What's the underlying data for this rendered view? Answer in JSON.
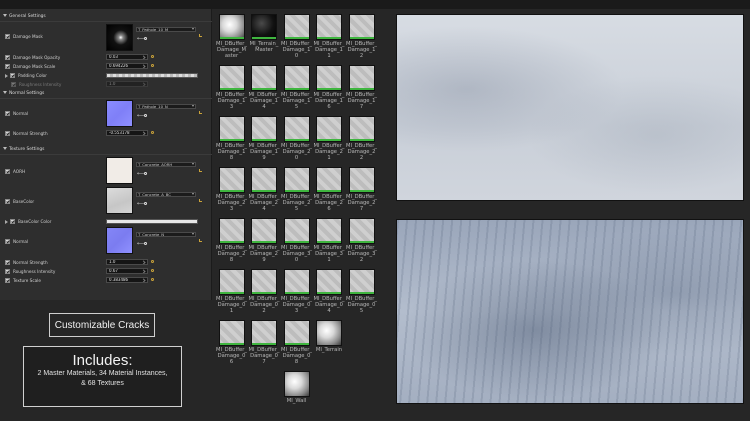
{
  "sections": {
    "general": "General Settings",
    "normal": "Normal Settings",
    "texture": "Texture Settings"
  },
  "general": {
    "damage_mask": {
      "label": "Damage Mask",
      "texture": "T_Pathole_10_M"
    },
    "opacity": {
      "label": "Damage Mask Opacity",
      "value": "0.03"
    },
    "scale": {
      "label": "Damage Mask Scale",
      "value": "0.694226"
    },
    "padding": {
      "label": "Padding Color"
    },
    "roughness": {
      "label": "Roughness Intensity",
      "value": "1.0"
    }
  },
  "normal": {
    "normal": {
      "label": "Normal",
      "texture": "T_Pathole_10_N"
    },
    "strength": {
      "label": "Normal Strength",
      "value": "-0.553178"
    }
  },
  "texture": {
    "aorm": {
      "label": "AORH",
      "texture": "T_Concrete_AORH"
    },
    "basecolor": {
      "label": "BaseColor",
      "texture": "T_Concrete_A_BC"
    },
    "basecolor_color": {
      "label": "BaseColor Color"
    },
    "normal": {
      "label": "Normal",
      "texture": "T_Concrete_N"
    },
    "normal_strength": {
      "label": "Normal Strength",
      "value": "1.0"
    },
    "roughness": {
      "label": "Roughness Intensity",
      "value": "0.67"
    },
    "scale": {
      "label": "Texture Scale",
      "value": "0.383486"
    }
  },
  "assets": [
    "MI_DBuffer_Damage_Master",
    "MI_Terrain_Master",
    "MI_DBuffer_Damage_10",
    "MI_DBuffer_Damage_11",
    "MI_DBuffer_Damage_12",
    "MI_DBuffer_Damage_13",
    "MI_DBuffer_Damage_14",
    "MI_DBuffer_Damage_15",
    "MI_DBuffer_Damage_16",
    "MI_DBuffer_Damage_17",
    "MI_DBuffer_Damage_18",
    "MI_DBuffer_Damage_19",
    "MI_DBuffer_Damage_20",
    "MI_DBuffer_Damage_21",
    "MI_DBuffer_Damage_22",
    "MI_DBuffer_Damage_23",
    "MI_DBuffer_Damage_24",
    "MI_DBuffer_Damage_25",
    "MI_DBuffer_Damage_26",
    "MI_DBuffer_Damage_27",
    "MI_DBuffer_Damage_28",
    "MI_DBuffer_Damage_29",
    "MI_DBuffer_Damage_30",
    "MI_DBuffer_Damage_31",
    "MI_DBuffer_Damage_32",
    "MI_DBuffer_Damage_01",
    "MI_DBuffer_Damage_02",
    "MI_DBuffer_Damage_03",
    "MI_DBuffer_Damage_04",
    "MI_DBuffer_Damage_05",
    "MI_DBuffer_Damage_06",
    "MI_DBuffer_Damage_07",
    "MI_DBuffer_Damage_08",
    "MI_Terrain",
    "MI_Wall"
  ],
  "features": {
    "cracks": "Customizable Cracks",
    "includes_title": "Includes:",
    "includes_line1": "2 Master Materials, 34 Material Instances,",
    "includes_line2": "& 68 Textures"
  }
}
